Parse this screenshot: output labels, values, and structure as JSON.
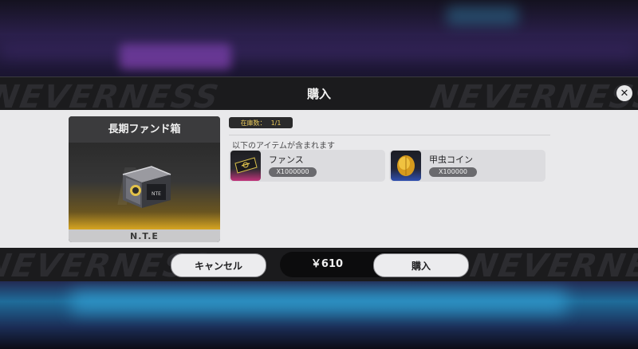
{
  "dialog": {
    "title": "購入",
    "close_icon": "close-icon"
  },
  "product": {
    "name": "長期ファンド箱",
    "brand": "N.T.E",
    "icon": "loot-box-icon"
  },
  "stock": {
    "label": "在庫数：",
    "value": "1/1"
  },
  "contents": {
    "label": "以下のアイテムが含まれます",
    "items": [
      {
        "name": "ファンス",
        "quantity": "X1000000",
        "icon": "fans-ticket-icon",
        "frame_color": "#c0337a"
      },
      {
        "name": "甲虫コイン",
        "quantity": "X100000",
        "icon": "beetle-coin-icon",
        "frame_color": "#2f4fb0"
      }
    ]
  },
  "footer": {
    "cancel_label": "キャンセル",
    "price": "￥610",
    "buy_label": "購入"
  },
  "background_watermark": "NEVERNESS"
}
